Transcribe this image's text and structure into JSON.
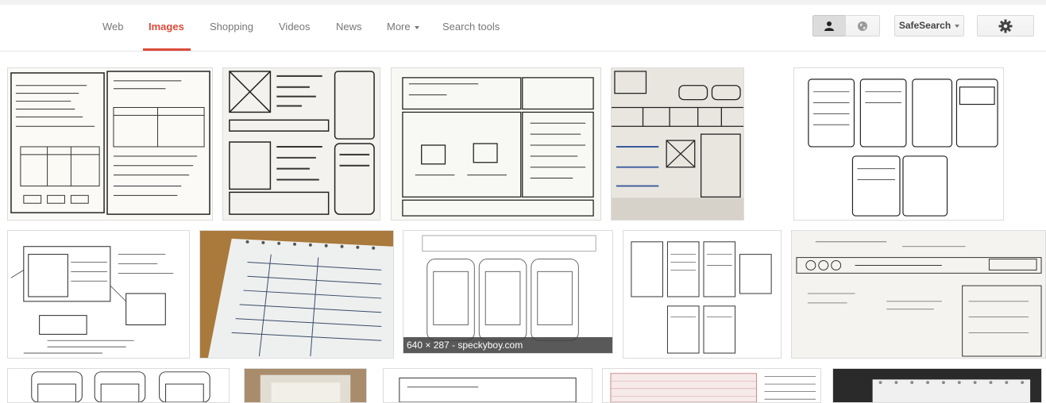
{
  "nav": {
    "tabs": [
      {
        "label": "Web"
      },
      {
        "label": "Images",
        "active": true
      },
      {
        "label": "Shopping"
      },
      {
        "label": "Videos"
      },
      {
        "label": "News"
      },
      {
        "label": "More"
      },
      {
        "label": "Search tools"
      }
    ],
    "safesearch_label": "SafeSearch",
    "accent_color": "#dd4b39",
    "icons": [
      "person-icon",
      "globe-icon",
      "gear-icon",
      "caret-down-icon"
    ]
  },
  "results": {
    "hover_caption": "640 × 287 - speckyboy.com"
  }
}
